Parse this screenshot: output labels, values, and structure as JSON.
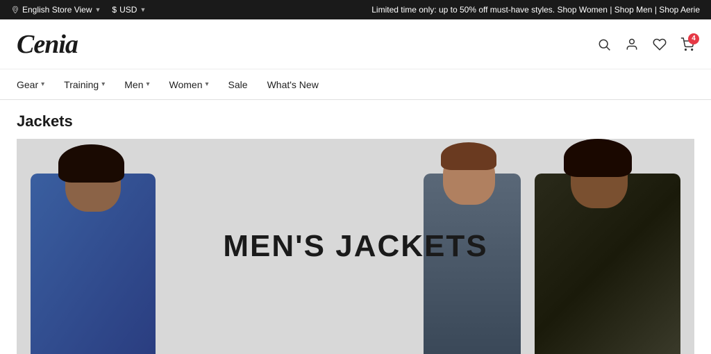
{
  "topbar": {
    "store_view": "English Store View",
    "currency": "USD",
    "promo_text": "Limited time only: up to 50% off must-have styles.",
    "shop_women": "Shop Women",
    "shop_men": "Shop Men",
    "shop_aerie": "Shop Aerie"
  },
  "header": {
    "logo": "Cenia",
    "cart_count": "4",
    "wishlist_count": "0"
  },
  "nav": {
    "items": [
      {
        "label": "Gear",
        "has_dropdown": true
      },
      {
        "label": "Training",
        "has_dropdown": true
      },
      {
        "label": "Men",
        "has_dropdown": true
      },
      {
        "label": "Women",
        "has_dropdown": true
      },
      {
        "label": "Sale",
        "has_dropdown": false
      },
      {
        "label": "What's New",
        "has_dropdown": false
      }
    ]
  },
  "page": {
    "title": "Jackets",
    "banner_text": "MEN'S JACKETS"
  }
}
